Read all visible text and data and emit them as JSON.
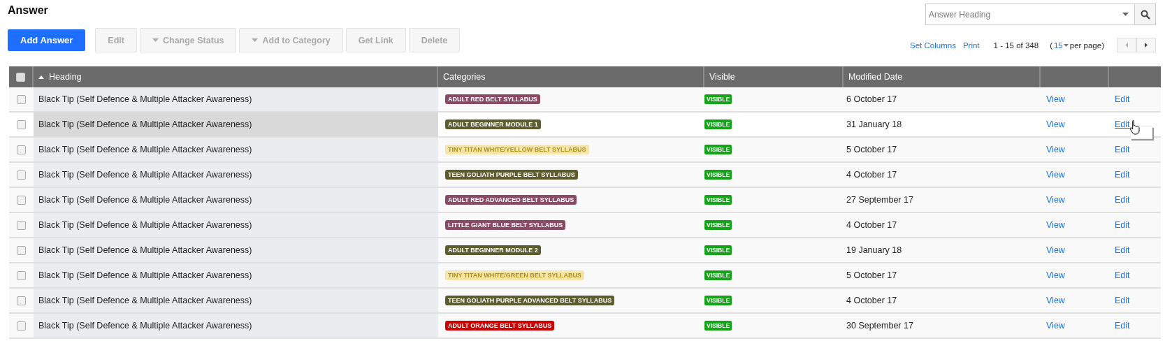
{
  "title": "Answer",
  "toolbar": {
    "primary": "Add Answer",
    "buttons": [
      {
        "label": "Edit",
        "dropdown": false,
        "disabled": true
      },
      {
        "label": "Change Status",
        "dropdown": true,
        "disabled": true
      },
      {
        "label": "Add to Category",
        "dropdown": true,
        "disabled": true
      },
      {
        "label": "Get Link",
        "dropdown": false,
        "disabled": true
      },
      {
        "label": "Delete",
        "dropdown": false,
        "disabled": true
      }
    ]
  },
  "search": {
    "placeholder": "Answer Heading"
  },
  "pager": {
    "links": [
      "Set Columns",
      "Print"
    ],
    "range": "1 - 15 of 348",
    "per_page_open": "(",
    "per_page_value": "15",
    "per_page_close": "per page)"
  },
  "table": {
    "select_all_checked": false,
    "columns": [
      "Heading",
      "Categories",
      "Visible",
      "Modified Date"
    ],
    "rows": [
      {
        "checked": false,
        "hovered": false,
        "heading": "Black Tip (Self Defence & Multiple Attacker Awareness)",
        "category": "ADULT RED BELT SYLLABUS",
        "color": "#8a4a63",
        "visible": "VISIBLE",
        "date": "6 October 17",
        "view": "View",
        "edit": "Edit"
      },
      {
        "checked": false,
        "hovered": true,
        "heading": "Black Tip (Self Defence & Multiple Attacker Awareness)",
        "category": "ADULT BEGINNER MODULE 1",
        "color": "#5c5c2e",
        "visible": "VISIBLE",
        "date": "31 January 18",
        "view": "View",
        "edit": "Edit"
      },
      {
        "checked": false,
        "hovered": false,
        "heading": "Black Tip (Self Defence & Multiple Attacker Awareness)",
        "category": "TINY TITAN WHITE/YELLOW BELT SYLLABUS",
        "color": "#f5e5a9",
        "visible": "VISIBLE",
        "date": "5 October 17",
        "view": "View",
        "edit": "Edit"
      },
      {
        "checked": false,
        "hovered": false,
        "heading": "Black Tip (Self Defence & Multiple Attacker Awareness)",
        "category": "TEEN GOLIATH PURPLE BELT SYLLABUS",
        "color": "#5c5c2e",
        "visible": "VISIBLE",
        "date": "4 October 17",
        "view": "View",
        "edit": "Edit"
      },
      {
        "checked": false,
        "hovered": false,
        "heading": "Black Tip (Self Defence & Multiple Attacker Awareness)",
        "category": "ADULT RED ADVANCED BELT SYLLABUS",
        "color": "#8a4a63",
        "visible": "VISIBLE",
        "date": "27 September 17",
        "view": "View",
        "edit": "Edit"
      },
      {
        "checked": false,
        "hovered": false,
        "heading": "Black Tip (Self Defence & Multiple Attacker Awareness)",
        "category": "LITTLE GIANT BLUE BELT SYLLABUS",
        "color": "#8a4a63",
        "visible": "VISIBLE",
        "date": "4 October 17",
        "view": "View",
        "edit": "Edit"
      },
      {
        "checked": false,
        "hovered": false,
        "heading": "Black Tip (Self Defence & Multiple Attacker Awareness)",
        "category": "ADULT BEGINNER MODULE 2",
        "color": "#5c5c2e",
        "visible": "VISIBLE",
        "date": "19 January 18",
        "view": "View",
        "edit": "Edit"
      },
      {
        "checked": false,
        "hovered": false,
        "heading": "Black Tip (Self Defence & Multiple Attacker Awareness)",
        "category": "TINY TITAN WHITE/GREEN BELT SYLLABUS",
        "color": "#f5e5a9",
        "visible": "VISIBLE",
        "date": "5 October 17",
        "view": "View",
        "edit": "Edit"
      },
      {
        "checked": false,
        "hovered": false,
        "heading": "Black Tip (Self Defence & Multiple Attacker Awareness)",
        "category": "TEEN GOLIATH PURPLE ADVANCED BELT SYLLABUS",
        "color": "#5c5c2e",
        "visible": "VISIBLE",
        "date": "4 October 17",
        "view": "View",
        "edit": "Edit"
      },
      {
        "checked": false,
        "hovered": false,
        "heading": "Black Tip (Self Defence & Multiple Attacker Awareness)",
        "category": "ADULT ORANGE BELT SYLLABUS",
        "color": "#cc0000",
        "visible": "VISIBLE",
        "date": "30 September 17",
        "view": "View",
        "edit": "Edit"
      }
    ]
  }
}
